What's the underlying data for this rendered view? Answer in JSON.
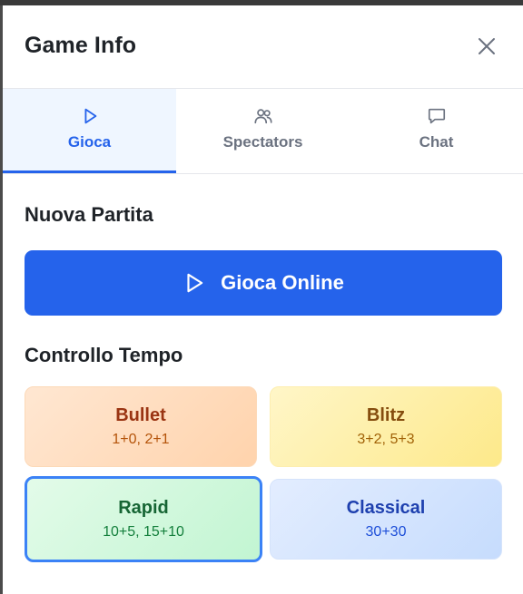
{
  "panel": {
    "title": "Game Info",
    "close_icon": "close-icon"
  },
  "tabs": [
    {
      "label": "Gioca",
      "icon": "play-icon",
      "active": true
    },
    {
      "label": "Spectators",
      "icon": "users-icon",
      "active": false
    },
    {
      "label": "Chat",
      "icon": "chat-bubble-icon",
      "active": false
    }
  ],
  "new_game": {
    "section_title": "Nuova Partita",
    "play_button_label": "Gioca Online",
    "play_button_icon": "play-icon"
  },
  "time_control": {
    "section_title": "Controllo Tempo",
    "options": [
      {
        "name": "Bullet",
        "values": "1+0, 2+1",
        "selected": false
      },
      {
        "name": "Blitz",
        "values": "3+2, 5+3",
        "selected": false
      },
      {
        "name": "Rapid",
        "values": "10+5, 15+10",
        "selected": true
      },
      {
        "name": "Classical",
        "values": "30+30",
        "selected": false
      }
    ]
  },
  "colors": {
    "accent": "#2563eb",
    "selected_border": "#3b82f6"
  }
}
